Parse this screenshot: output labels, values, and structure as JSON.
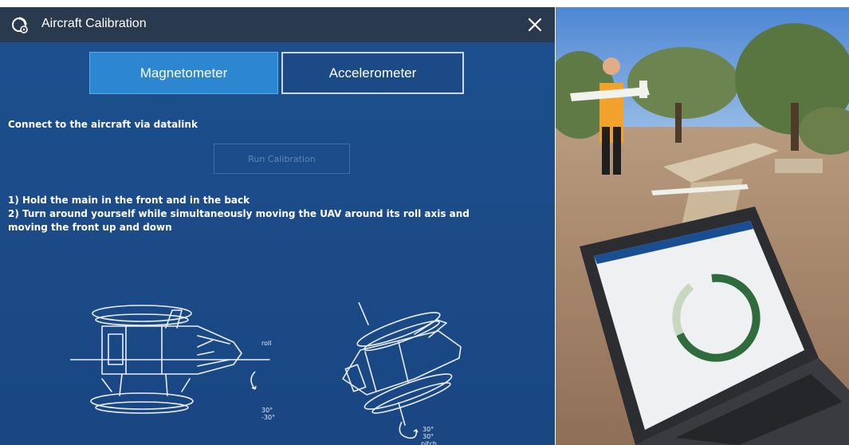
{
  "dialog": {
    "title": "Aircraft Calibration",
    "icon": "calibration-icon",
    "close_icon": "close-icon"
  },
  "tabs": [
    {
      "label": "Magnetometer",
      "active": true
    },
    {
      "label": "Accelerometer",
      "active": false
    }
  ],
  "status_text": "Connect to the aircraft via datalink",
  "run_button_label": "Run Calibration",
  "instructions": [
    "1) Hold the main in the front and in the back",
    "2) Turn around yourself while simultaneously moving the UAV around its roll axis and",
    "moving the front up and down"
  ],
  "diagram_labels": {
    "roll": "roll",
    "roll_range_1": "30°",
    "roll_range_2": "-30°",
    "pitch": "pitch",
    "pitch_range_1": "30°",
    "pitch_range_2": "30°"
  },
  "colors": {
    "titlebar": "#2a3a4e",
    "panel": "#1b4a86",
    "active_tab": "#2d86d0"
  }
}
